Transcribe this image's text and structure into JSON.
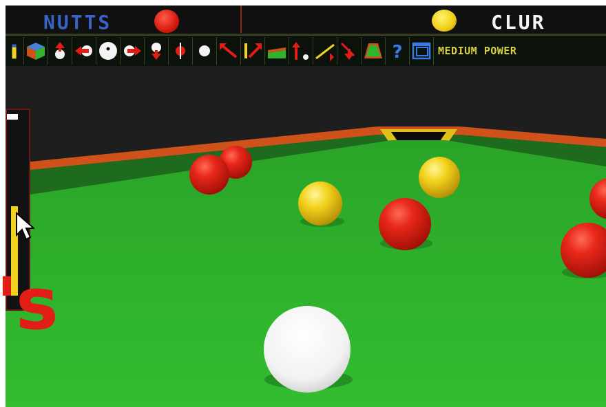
{
  "scoreboard": {
    "player1_name": "NUTTS",
    "player1_ball_color": "red",
    "player2_name": "CLUR",
    "player2_ball_color": "yellow"
  },
  "toolbar": {
    "icons": [
      "power-level-icon",
      "view-cube-icon",
      "move-up-icon",
      "move-left-icon",
      "cue-ball-spin-icon",
      "move-right-icon",
      "move-down-icon",
      "rotate-icon",
      "small-cue-ball-icon",
      "aim-left-icon",
      "aim-right-icon",
      "table-view-icon",
      "shot-arrows-icon",
      "cue-angle-icon",
      "zoom-out-icon",
      "overhead-table-icon",
      "help-icon",
      "options-window-icon"
    ],
    "power_label": "MEDIUM POWER"
  },
  "overlay_text": "'s",
  "colors": {
    "felt": "#2fb52c",
    "cushion": "#1d6a1c",
    "rail": "#d4561c",
    "red_ball": "#d91b0f",
    "yellow_ball": "#f0cc16",
    "cue_ball": "#f4f4f4",
    "accent_text": "#d7cf47"
  }
}
